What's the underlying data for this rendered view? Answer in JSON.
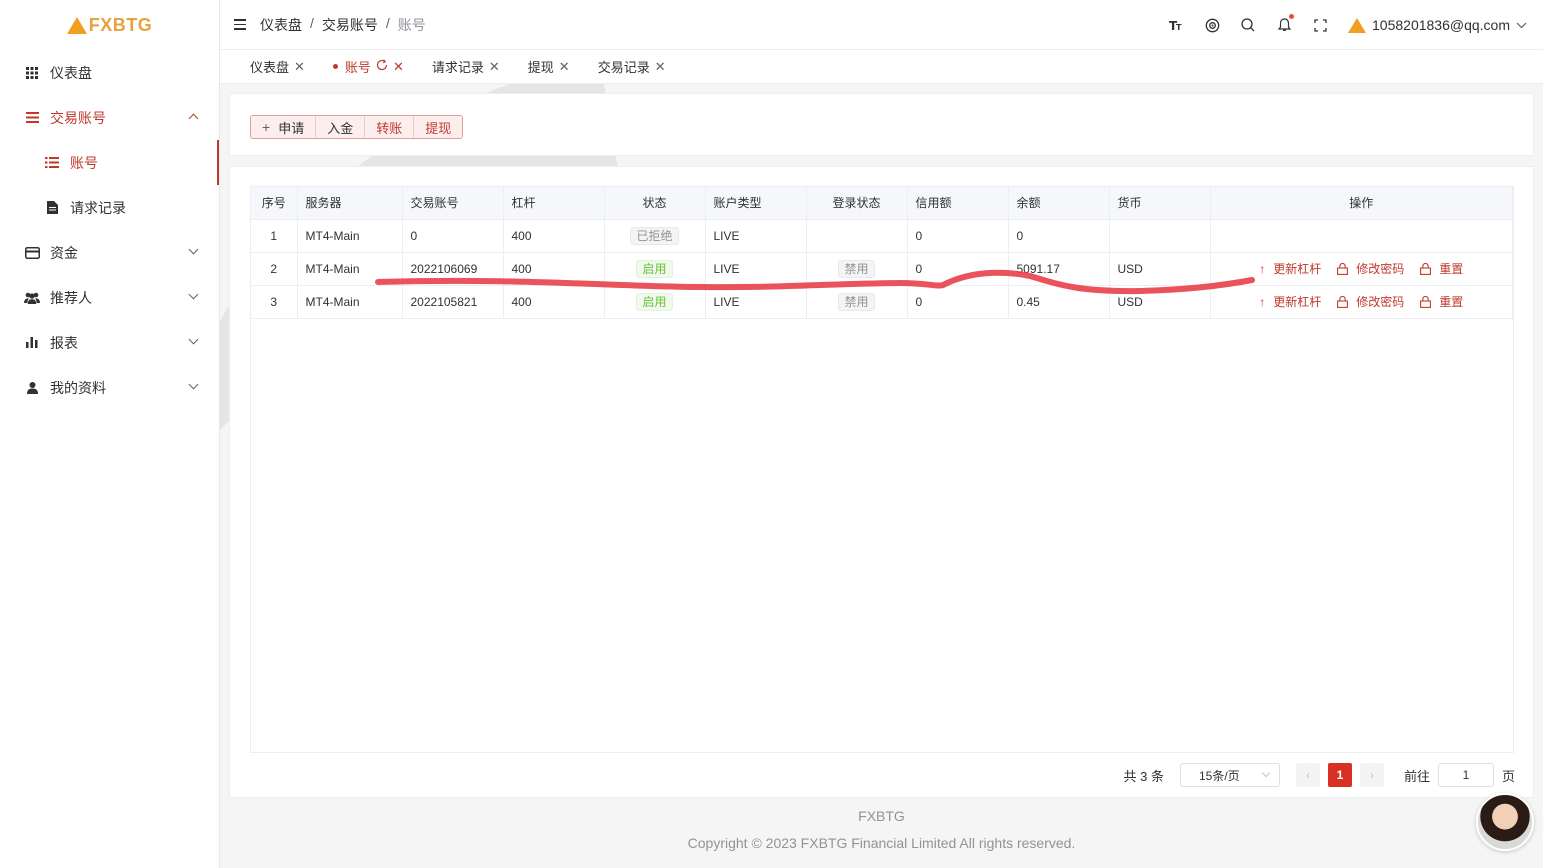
{
  "brand": {
    "name": "FXBTG"
  },
  "sidebar": {
    "items": [
      {
        "label": "仪表盘",
        "icon": "grid-icon"
      },
      {
        "label": "交易账号",
        "icon": "list-icon",
        "expanded": true,
        "children": [
          {
            "label": "账号",
            "icon": "list-icon",
            "active": true
          },
          {
            "label": "请求记录",
            "icon": "document-icon"
          }
        ]
      },
      {
        "label": "资金",
        "icon": "card-icon"
      },
      {
        "label": "推荐人",
        "icon": "users-icon"
      },
      {
        "label": "报表",
        "icon": "bar-chart-icon"
      },
      {
        "label": "我的资料",
        "icon": "user-icon"
      }
    ]
  },
  "header": {
    "breadcrumb": [
      "仪表盘",
      "交易账号",
      "账号"
    ],
    "user_email": "1058201836@qq.com",
    "icons": [
      "font-size-icon",
      "target-icon",
      "search-icon",
      "bell-icon",
      "fullscreen-icon"
    ]
  },
  "tags": [
    {
      "label": "仪表盘",
      "active": false
    },
    {
      "label": "账号",
      "active": true
    },
    {
      "label": "请求记录",
      "active": false
    },
    {
      "label": "提现",
      "active": false
    },
    {
      "label": "交易记录",
      "active": false
    }
  ],
  "toolbar": {
    "apply": "申请",
    "deposit": "入金",
    "transfer": "转账",
    "withdraw": "提现"
  },
  "table": {
    "headers": [
      "序号",
      "服务器",
      "交易账号",
      "杠杆",
      "状态",
      "账户类型",
      "登录状态",
      "信用额",
      "余额",
      "货币",
      "操作"
    ],
    "rows": [
      {
        "no": "1",
        "server": "MT4-Main",
        "account": "0",
        "leverage": "400",
        "status": "已拒绝",
        "status_type": "gray",
        "type": "LIVE",
        "login": "",
        "credit": "0",
        "balance": "0",
        "currency": "",
        "ops": false
      },
      {
        "no": "2",
        "server": "MT4-Main",
        "account": "2022106069",
        "leverage": "400",
        "status": "启用",
        "status_type": "green",
        "type": "LIVE",
        "login": "禁用",
        "credit": "0",
        "balance": "5091.17",
        "currency": "USD",
        "ops": true
      },
      {
        "no": "3",
        "server": "MT4-Main",
        "account": "2022105821",
        "leverage": "400",
        "status": "启用",
        "status_type": "green",
        "type": "LIVE",
        "login": "禁用",
        "credit": "0",
        "balance": "0.45",
        "currency": "USD",
        "ops": true
      }
    ],
    "ops_labels": {
      "leverage": "更新杠杆",
      "password": "修改密码",
      "reset": "重置"
    }
  },
  "pagination": {
    "total": "共 3 条",
    "page_size": "15条/页",
    "current": "1",
    "goto_label": "前往",
    "goto_value": "1",
    "page_suffix": "页"
  },
  "footer": {
    "brand": "FXBTG",
    "copyright": "Copyright © 2023 FXBTG Financial Limited All rights reserved."
  },
  "colors": {
    "accent": "#c0392b",
    "brand": "#e6a23c",
    "annotation": "#e8404a"
  }
}
